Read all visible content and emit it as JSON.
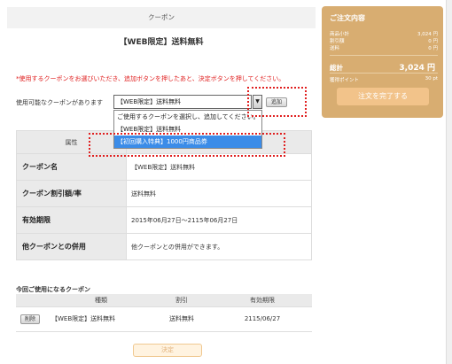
{
  "header": {
    "section": "クーポン",
    "title": "【WEB限定】送料無料"
  },
  "notice": "*使用するクーポンをお選びいただき、追加ボタンを押したあと、決定ボタンを押してください。",
  "selector": {
    "label": "使用可能なクーポンがあります",
    "selected": "【WEB限定】送料無料",
    "add_label": "追加",
    "options": [
      "ご使用するクーポンを選択し、追加してください。",
      "【WEB限定】送料無料",
      "【初回購入特典】1000円商品券"
    ]
  },
  "attributes": {
    "header": "属性",
    "rows": [
      {
        "key": "クーポン名",
        "value": "【WEB限定】送料無料"
      },
      {
        "key": "クーポン割引額/率",
        "value": "送料無料"
      },
      {
        "key": "有効期限",
        "value": "2015年06月27日～2115年06月27日"
      },
      {
        "key": "他クーポンとの併用",
        "value": "他クーポンとの併用ができます。"
      }
    ]
  },
  "used": {
    "label": "今回ご使用になるクーポン",
    "columns": [
      "種類",
      "割引",
      "有効期限"
    ],
    "rows": [
      {
        "delete_label": "削除",
        "type": "【WEB限定】送料無料",
        "discount": "送料無料",
        "expiry": "2115/06/27"
      }
    ]
  },
  "decide_label": "決定",
  "summary": {
    "title": "ご注文内容",
    "rows": [
      {
        "label": "商品小計",
        "value": "3,024 円"
      },
      {
        "label": "割引額",
        "value": "0 円"
      },
      {
        "label": "送料",
        "value": "0 円"
      }
    ],
    "total_label": "総計",
    "total_value": "3,024 円",
    "points_label": "獲得ポイント",
    "points_value": "30 pt",
    "complete_label": "注文を完了する"
  },
  "colors": {
    "accent": "#d8ad71",
    "notice": "#e02020",
    "highlight": "#3b8ce8"
  }
}
